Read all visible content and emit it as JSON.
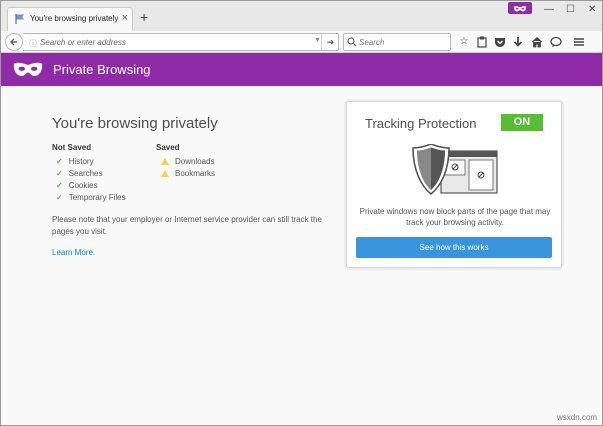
{
  "tab": {
    "title": "You're browsing privately",
    "close": "×"
  },
  "newtab_label": "+",
  "window_controls": {
    "minimize": "—",
    "maximize": "☐",
    "close": "✕"
  },
  "urlbar": {
    "placeholder": "Search or enter address",
    "go": "➔",
    "dropdown": "▼"
  },
  "searchbar": {
    "placeholder": "Search"
  },
  "toolbar_icons": [
    "star-icon",
    "reader-list-icon",
    "pocket-icon",
    "download-icon",
    "home-icon",
    "chat-icon",
    "menu-icon"
  ],
  "banner": {
    "title": "Private Browsing"
  },
  "main": {
    "heading": "You're browsing privately",
    "not_saved": {
      "title": "Not Saved",
      "items": [
        "History",
        "Searches",
        "Cookies",
        "Temporary Files"
      ]
    },
    "saved": {
      "title": "Saved",
      "items": [
        "Downloads",
        "Bookmarks"
      ]
    },
    "note": "Please note that your employer or Internet service provider can still track the pages you visit.",
    "learn_more": "Learn More."
  },
  "tracking": {
    "title": "Tracking Protection",
    "status": "ON",
    "description": "Private windows now block parts of the page that may track your browsing activity.",
    "button": "See how this works"
  },
  "watermark": "wsxdn.com",
  "colors": {
    "accent_purple": "#8f2ba7",
    "on_green": "#57bd35",
    "button_blue": "#3a94dc",
    "link_blue": "#0a84c7"
  }
}
